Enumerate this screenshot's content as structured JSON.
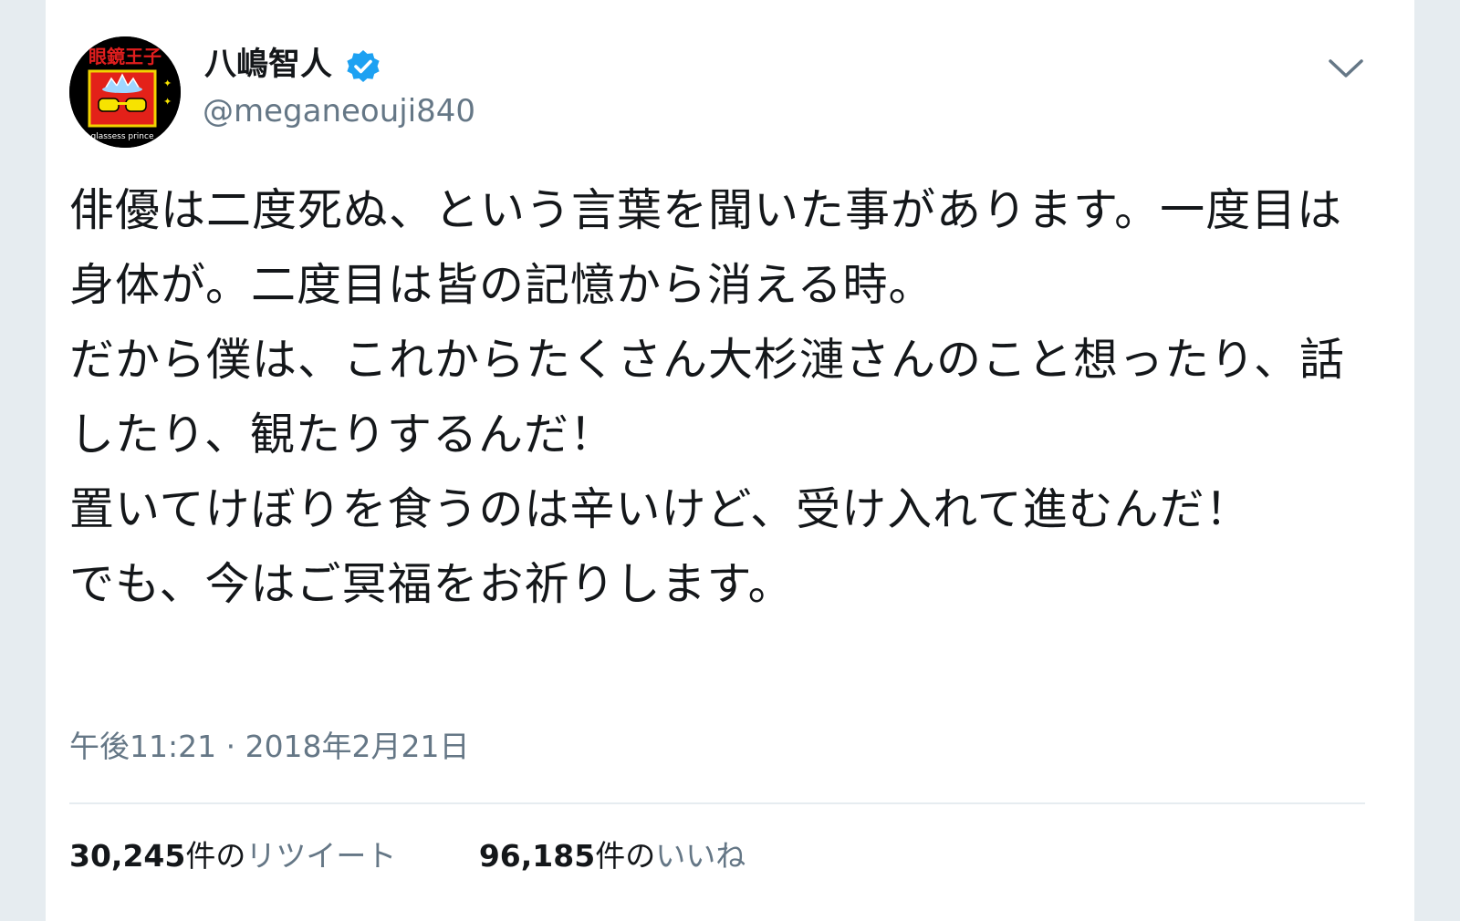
{
  "tweet": {
    "author": {
      "display_name": "八嶋智人",
      "handle": "@meganeouji840",
      "verified": true,
      "avatar_text_top": "眼鏡王子",
      "avatar_text_bottom": "glassess prince"
    },
    "text": "俳優は二度死ぬ、という言葉を聞いた事があります。一度目は身体が。二度目は皆の記憶から消える時。\nだから僕は、これからたくさん大杉漣さんのこと想ったり、話したり、観たりするんだ！\n置いてけぼりを食うのは辛いけど、受け入れて進むんだ！\nでも、今はご冥福をお祈りします。",
    "timestamp": "午後11:21 · 2018年2月21日",
    "stats": {
      "retweets": {
        "count": "30,245",
        "unit": "件の",
        "label": "リツイート"
      },
      "likes": {
        "count": "96,185",
        "unit": "件の",
        "label": "いいね"
      }
    }
  },
  "colors": {
    "text": "#14171a",
    "secondary": "#657786",
    "verified": "#1da1f2",
    "background": "#e6ecf0"
  },
  "icons": {
    "verified": "verified-badge-icon",
    "more": "chevron-down-icon"
  }
}
